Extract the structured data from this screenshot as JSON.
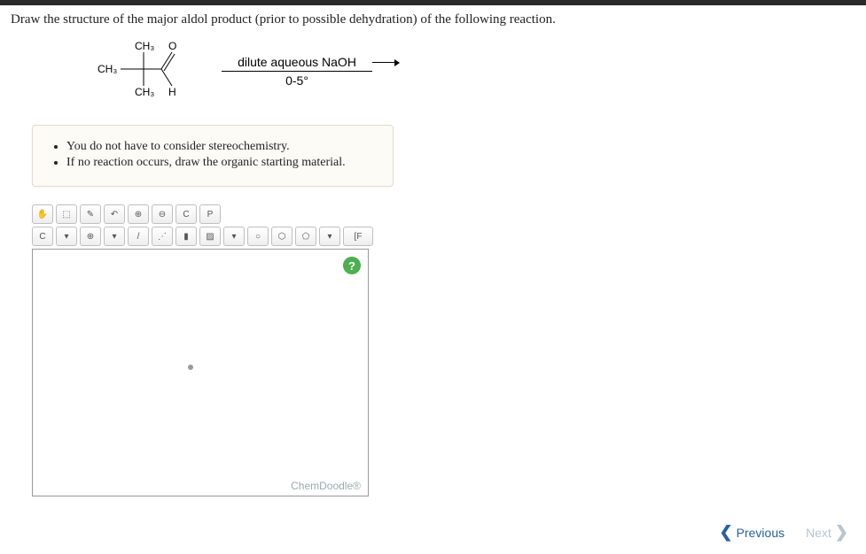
{
  "question": "Draw the structure of the major aldol product (prior to possible dehydration) of the following reaction.",
  "structure": {
    "ch3_top": "CH₃",
    "ch3_left": "CH₃",
    "ch3_bottom": "CH₃",
    "o": "O",
    "h": "H"
  },
  "reagent": {
    "top": "dilute aqueous NaOH",
    "bottom": "0-5°"
  },
  "hints": {
    "items": [
      "You do not have to consider stereochemistry.",
      "If no reaction occurs, draw the organic starting material."
    ]
  },
  "toolbar": {
    "row1": {
      "move": "✋",
      "lasso": "⬚",
      "erase": "✎",
      "undo": "↶",
      "zoom_in": "⊕",
      "zoom_out": "⊖",
      "copy": "C",
      "paste": "P"
    },
    "row2": {
      "carbon": "C",
      "dropdown": "▾",
      "charge": "⊕",
      "dropdown2": "▾",
      "bond1": "/",
      "bond2": "⋰",
      "bond3": "▮",
      "bond4": "▨",
      "dropdown3": "▾",
      "ring1": "○",
      "ring2": "⬡",
      "ring3": "⬠",
      "dropdown4": "▾",
      "bracket": "[F"
    }
  },
  "canvas": {
    "help": "?",
    "brand": "ChemDoodle®"
  },
  "nav": {
    "previous": "Previous",
    "next": "Next"
  }
}
